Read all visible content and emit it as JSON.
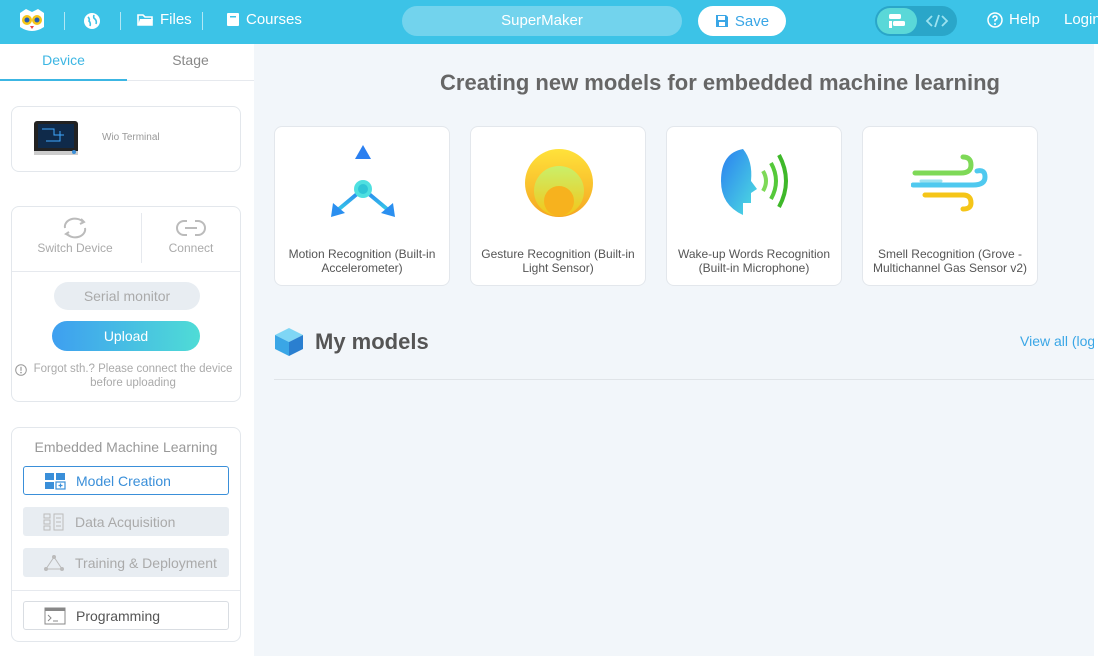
{
  "topbar": {
    "files": "Files",
    "courses": "Courses",
    "project_name": "SuperMaker",
    "save": "Save",
    "help": "Help",
    "login": "Login"
  },
  "left": {
    "tabs": [
      "Device",
      "Stage"
    ],
    "device_name": "Wio Terminal",
    "switch_device": "Switch Device",
    "connect": "Connect",
    "serial_monitor": "Serial monitor",
    "upload": "Upload",
    "hint": "Forgot sth.? Please connect the device before uploading",
    "eml_title": "Embedded Machine Learning",
    "menu": {
      "model_creation": "Model Creation",
      "data_acquisition": "Data Acquisition",
      "training": "Training & Deployment",
      "programming": "Programming"
    }
  },
  "main": {
    "title": "Creating new models for embedded machine learning",
    "cards": [
      "Motion Recognition (Built-in Accelerometer)",
      "Gesture Recognition (Built-in Light Sensor)",
      "Wake-up Words Recognition (Built-in Microphone)",
      "Smell Recognition (Grove - Multichannel Gas Sensor v2)"
    ],
    "my_models": "My models",
    "view_all": "View all (log"
  },
  "colors": {
    "accent": "#3cc3e7",
    "primary": "#3a8fd9"
  }
}
